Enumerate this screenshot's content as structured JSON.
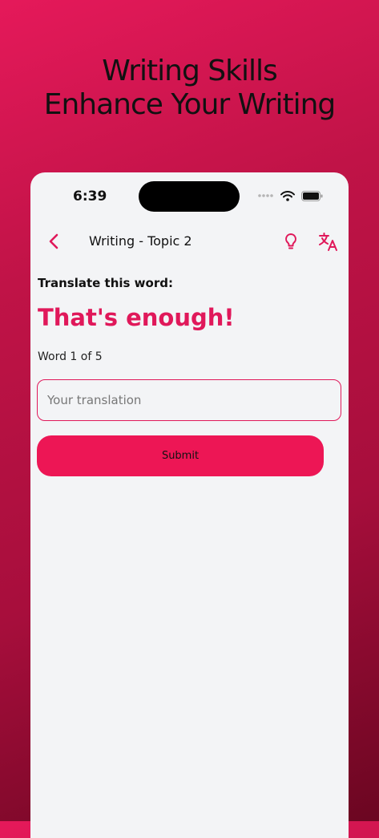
{
  "promo": {
    "line1": "Writing Skills",
    "line2": "Enhance Your Writing"
  },
  "status_bar": {
    "time": "6:39"
  },
  "nav": {
    "title": "Writing - Topic 2",
    "back_icon": "chevron-left-icon",
    "hint_icon": "lightbulb-icon",
    "translate_icon": "translate-icon"
  },
  "exercise": {
    "prompt": "Translate this word:",
    "word": "That's enough!",
    "progress": "Word 1 of 5",
    "input_placeholder": "Your translation",
    "input_value": "",
    "submit_label": "Submit"
  },
  "colors": {
    "accent": "#e0185a",
    "button": "#ed1655",
    "surface": "#f3f4f6",
    "gradient_top": "#e5195a",
    "gradient_bottom": "#6b0621"
  }
}
